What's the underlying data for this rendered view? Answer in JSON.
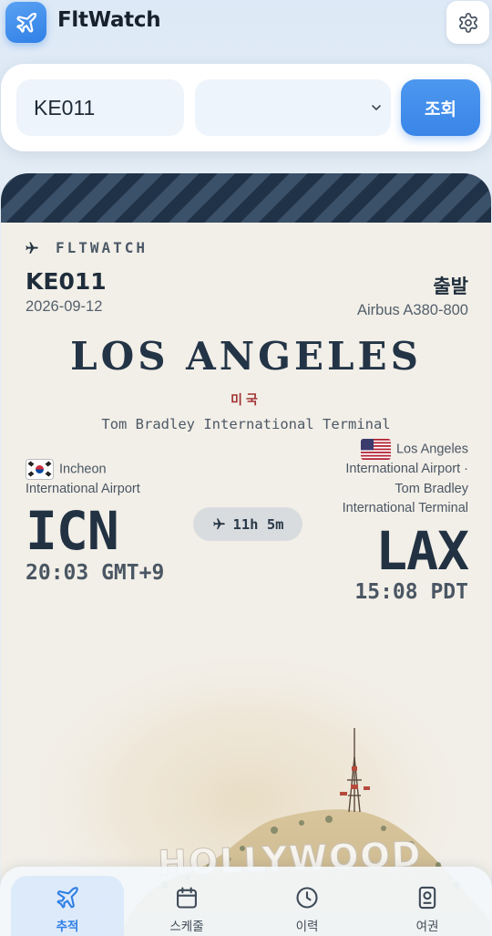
{
  "app": {
    "title": "FltWatch"
  },
  "search": {
    "flight_value": "KE011",
    "date_value": "",
    "query_label": "조회"
  },
  "ticket": {
    "brand": "FLTWATCH",
    "flight_number": "KE011",
    "date": "2026-09-12",
    "status": "출발",
    "aircraft": "Airbus A380-800",
    "destination_city": "LOS ANGELES",
    "destination_country": "미국",
    "destination_terminal": "Tom Bradley International Terminal",
    "duration": "11h 5m",
    "origin": {
      "airport_line1": "Incheon",
      "airport_line2": "International Airport",
      "code": "ICN",
      "time": "20:03 GMT+9"
    },
    "destination": {
      "airport_line1": "Los Angeles",
      "airport_line2": "International Airport ·",
      "airport_line3": "Tom Bradley",
      "airport_line4": "International Terminal",
      "code": "LAX",
      "time": "15:08 PDT"
    },
    "landmark_text": "HOLLYWOOD"
  },
  "nav": [
    {
      "label": "추적",
      "icon": "plane-icon",
      "active": true
    },
    {
      "label": "스케줄",
      "icon": "calendar-icon",
      "active": false
    },
    {
      "label": "이력",
      "icon": "clock-icon",
      "active": false
    },
    {
      "label": "여권",
      "icon": "passport-icon",
      "active": false
    }
  ],
  "colors": {
    "accent": "#3a86e8",
    "ticket_bg": "#f2efe8",
    "ink": "#223243",
    "country_red": "#a23434"
  }
}
